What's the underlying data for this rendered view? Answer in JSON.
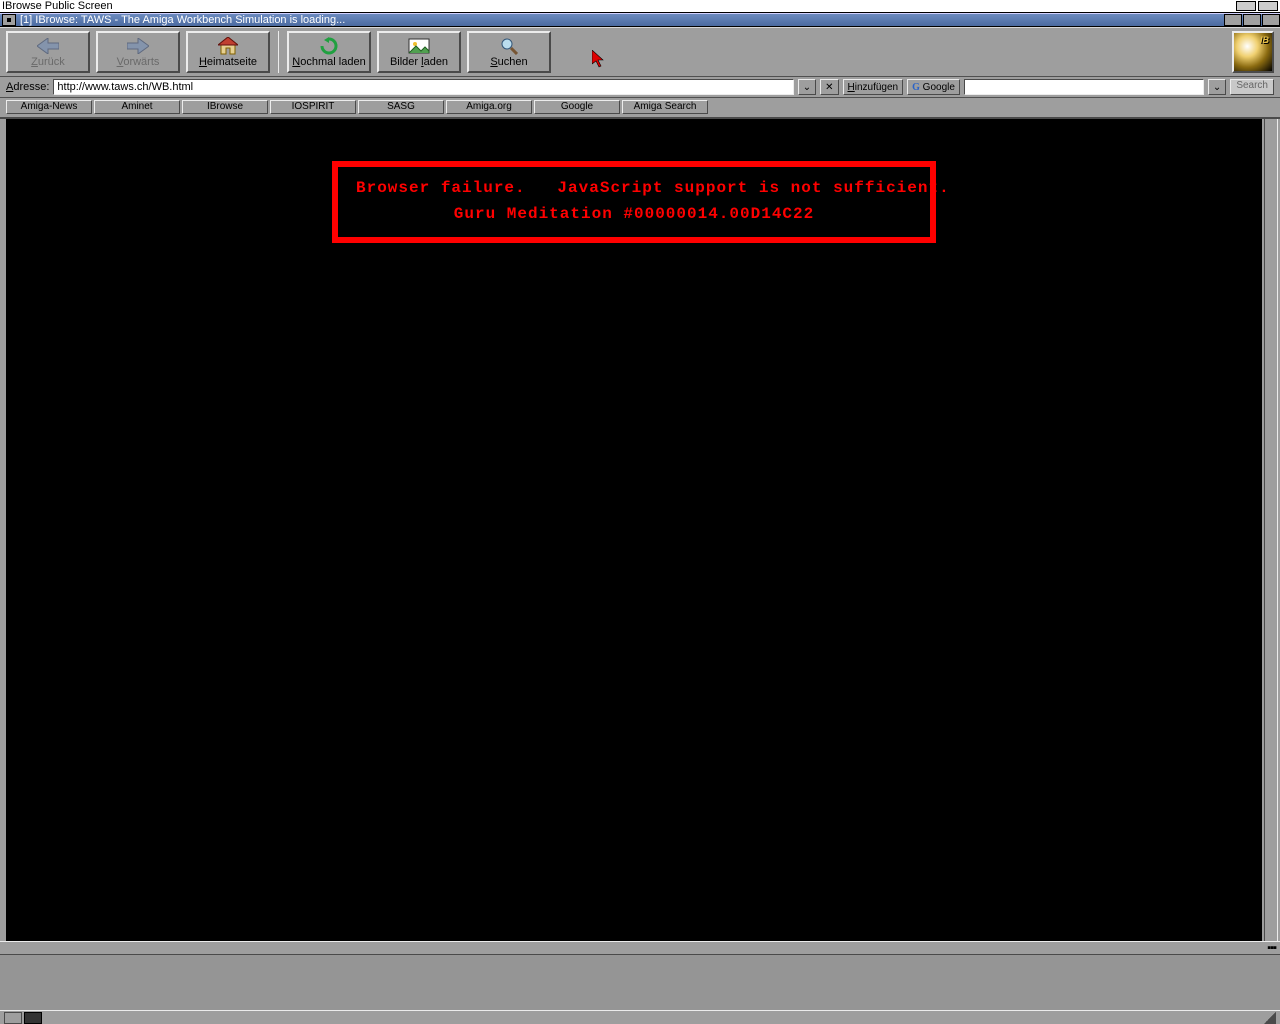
{
  "screen": {
    "title": "IBrowse Public Screen"
  },
  "window": {
    "title": "[1] IBrowse: TAWS - The Amiga Workbench Simulation is loading..."
  },
  "toolbar": {
    "back": "Zurück",
    "forward": "Vorwärts",
    "home": "Heimatseite",
    "reload": "Nochmal laden",
    "load_images": "Bilder laden",
    "search": "Suchen"
  },
  "address": {
    "label_letter": "A",
    "label_rest": "dresse:",
    "url": "http://www.taws.ch/WB.html",
    "add_button_letter": "H",
    "add_button_rest": "inzufügen",
    "engine_icon": "G",
    "engine_name": "Google",
    "search_button": "Search"
  },
  "bookmarks": [
    "Amiga-News",
    "Aminet",
    "IBrowse",
    "IOSPIRIT",
    "SASG",
    "Amiga.org",
    "Google",
    "Amiga Search"
  ],
  "error": {
    "line1": "Browser failure.   JavaScript support is not sufficient.",
    "line2": "Guru Meditation #00000014.00D14C22"
  }
}
